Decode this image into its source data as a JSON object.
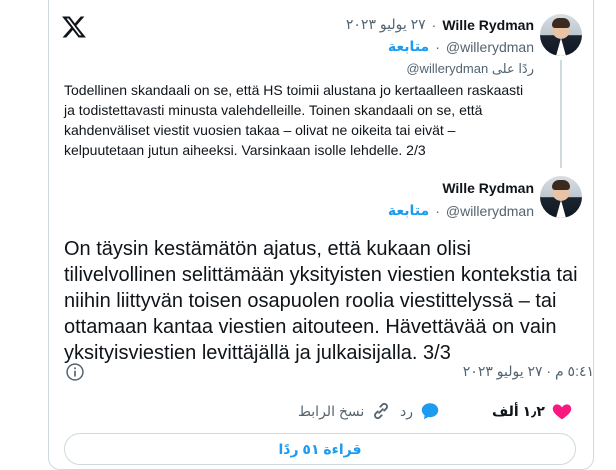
{
  "tweet1": {
    "author_name": "Wille Rydman",
    "author_handle": "@willerydman",
    "date": "٢٧ يوليو ٢٠٢٣",
    "follow_label": "متابعة",
    "replying_to_prefix": "ردًا على",
    "replying_to_handle": "@willerydman",
    "text": "Todellinen skandaali on se, että HS toimii alustana jo kertaalleen raskaasti ja todistettavasti minusta valehdelleille. Toinen skandaali on se, että kahdenväliset viestit vuosien takaa – olivat ne oikeita tai eivät – kelpuutetaan jutun aiheeksi. Varsinkaan isolle lehdelle. 2/3"
  },
  "tweet2": {
    "author_name": "Wille Rydman",
    "author_handle": "@willerydman",
    "follow_label": "متابعة",
    "text": "On täysin kestämätön ajatus, että kukaan olisi tilivelvollinen selittämään yksityisten viestien kontekstia tai niihin liittyvän toisen osapuolen roolia viestittelyssä – tai ottamaan kantaa viestien aitouteen. Hävettävää on vain yksityisviestien levittäjällä ja julkaisijalla. 3/3",
    "timestamp": "٥:٤١ م · ٢٧ يوليو ٢٠٢٣"
  },
  "actions": {
    "likes_count": "١٫٢ ألف",
    "reply_label": "رد",
    "copy_link_label": "نسخ الرابط",
    "read_replies_label": "قراءة ٥١ ردًا"
  },
  "colors": {
    "accent": "#1d9bf0",
    "like": "#f91880",
    "text": "#0f1419",
    "muted": "#536471",
    "border": "#cfd9de"
  },
  "icons": [
    "x-logo-icon",
    "info-icon",
    "heart-icon",
    "reply-bubble-icon",
    "link-icon"
  ]
}
